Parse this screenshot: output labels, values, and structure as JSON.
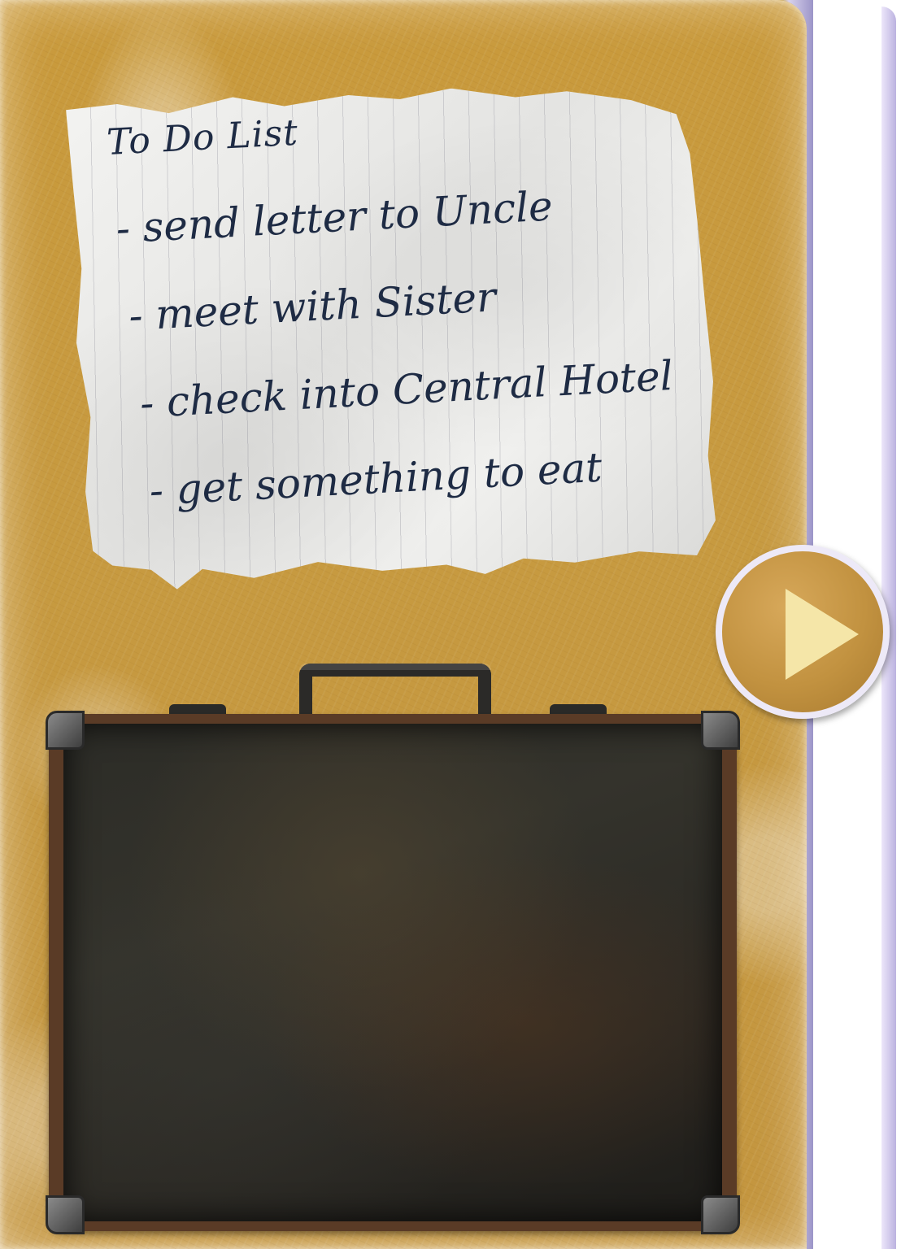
{
  "todo_note": {
    "title": "To Do List",
    "items": [
      "- send letter to Uncle",
      "- meet with Sister",
      "- check into Central Hotel",
      "- get something to eat"
    ]
  },
  "play_button": {
    "icon": "play-icon"
  },
  "inventory": {
    "icon": "suitcase-icon",
    "items": []
  },
  "colors": {
    "panel": "#c99a3c",
    "ink": "#1e2b44",
    "play_arrow": "#f5e6a8",
    "suitcase_interior": "#2c2c27"
  }
}
